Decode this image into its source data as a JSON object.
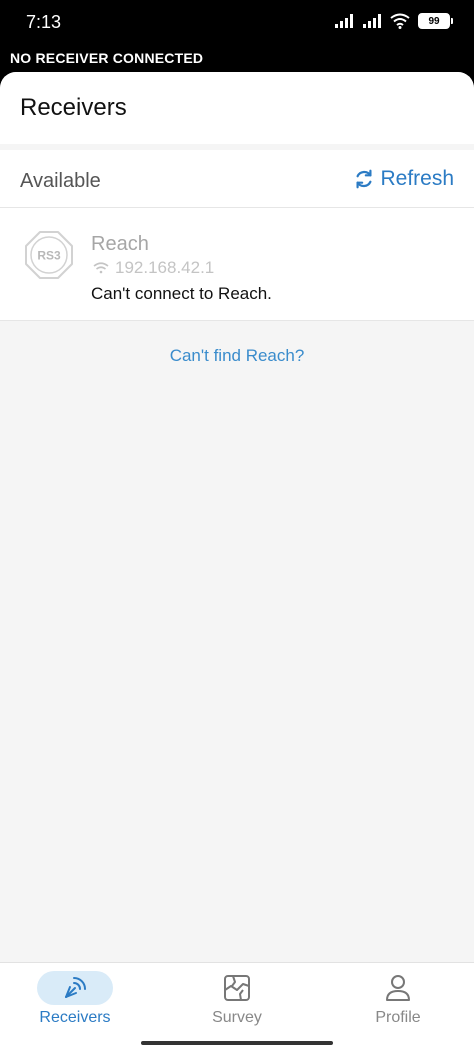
{
  "status_bar": {
    "time": "7:13",
    "battery": "99"
  },
  "banner": {
    "text": "NO RECEIVER CONNECTED"
  },
  "header": {
    "title": "Receivers"
  },
  "available": {
    "label": "Available",
    "refresh_label": "Refresh"
  },
  "receiver": {
    "badge": "RS3",
    "name": "Reach",
    "ip": "192.168.42.1",
    "status": "Can't connect to Reach."
  },
  "help": {
    "link_text": "Can't find Reach?"
  },
  "bottom_nav": {
    "items": [
      {
        "label": "Receivers",
        "icon": "satellite-icon",
        "active": true
      },
      {
        "label": "Survey",
        "icon": "map-icon",
        "active": false
      },
      {
        "label": "Profile",
        "icon": "person-icon",
        "active": false
      }
    ]
  },
  "colors": {
    "accent": "#2b7bc4",
    "link": "#3a8ccc",
    "background": "#f5f5f5"
  }
}
